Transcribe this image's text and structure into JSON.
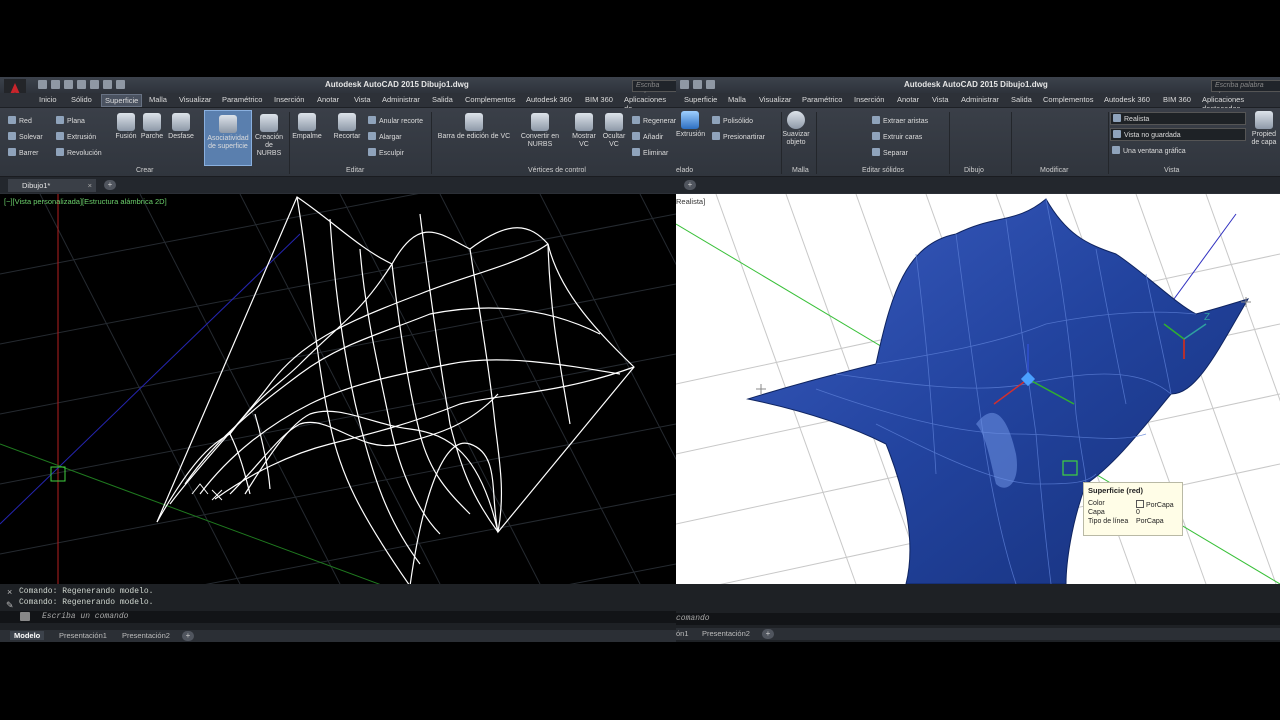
{
  "left": {
    "window_title": "Autodesk AutoCAD 2015   Dibujo1.dwg",
    "search_placeholder": "Escriba pala",
    "ribbon_tabs": [
      "Inicio",
      "Sólido",
      "Superficie",
      "Malla",
      "Visualizar",
      "Paramétrico",
      "Inserción",
      "Anotar",
      "Vista",
      "Administrar",
      "Salida",
      "Complementos",
      "Autodesk 360",
      "BIM 360",
      "Aplicaciones de"
    ],
    "active_tab": "Superficie",
    "ribbon": {
      "crear_small": [
        "Red",
        "Solevar",
        "Barrer",
        "Plana",
        "Extrusión",
        "Revolución"
      ],
      "crear_buttons": [
        "Fusión",
        "Parche",
        "Desfase"
      ],
      "asociatividad": [
        "Asociatividad",
        "de superficie"
      ],
      "creacion": [
        "Creación",
        "de NURBS"
      ],
      "panel_crear": "Crear",
      "empalme": "Empalme",
      "recortar": "Recortar",
      "editar_small": [
        "Anular recorte",
        "Alargar",
        "Esculpir"
      ],
      "panel_editar": "Editar",
      "barra_vc": "Barra de edición de VC",
      "convertir": [
        "Convertir en",
        "NURBS"
      ],
      "mostrar": [
        "Mostrar",
        "VC"
      ],
      "ocultar": [
        "Ocultar",
        "VC"
      ],
      "vertices_small": [
        "Regenerar",
        "Añadir",
        "Eliminar"
      ],
      "panel_vertices": "Vértices de control"
    },
    "file_tab": "Dibujo1*",
    "viewport_label": "[−][Vista personalizada][Estructura alámbrica 2D]",
    "command_history": [
      "Comando:  Regenerando modelo.",
      "Comando:  Regenerando modelo."
    ],
    "command_prompt": "Escriba un comando",
    "layout_tabs": [
      "Modelo",
      "Presentación1",
      "Presentación2"
    ]
  },
  "right": {
    "window_title": "Autodesk AutoCAD 2015   Dibujo1.dwg",
    "search_placeholder": "Escriba palabra clave",
    "ribbon_tabs": [
      "Superficie",
      "Malla",
      "Visualizar",
      "Paramétrico",
      "Inserción",
      "Anotar",
      "Vista",
      "Administrar",
      "Salida",
      "Complementos",
      "Autodesk 360",
      "BIM 360",
      "Aplicaciones destacadas"
    ],
    "ribbon": {
      "extrusion": "Extrusión",
      "modelado_small": [
        "Polisólido",
        "Presionartirar"
      ],
      "panel_modelado": "elado",
      "suavizar": [
        "Suavizar",
        "objeto"
      ],
      "panel_malla": "Malla",
      "editar_small": [
        "Extraer aristas",
        "Extruir caras",
        "Separar"
      ],
      "panel_editar_solidos": "Editar sólidos",
      "panel_dibujo": "Dibujo",
      "panel_modificar": "Modificar",
      "visual_style": "Realista",
      "view_saved": "Vista no guardada",
      "viewport_config": "Una ventana gráfica",
      "panel_vista": "Vista",
      "propiedades": [
        "Propied",
        "de capa"
      ]
    },
    "viewport_label": "Realista]",
    "tooltip": {
      "title": "Superficie (red)",
      "rows": [
        {
          "label": "Color",
          "value": "PorCapa"
        },
        {
          "label": "Capa",
          "value": "0"
        },
        {
          "label": "Tipo de línea",
          "value": "PorCapa"
        }
      ]
    },
    "axis_label": "Z",
    "command_prompt": "comando",
    "layout_tabs": [
      "ón1",
      "Presentación2"
    ]
  },
  "colors": {
    "accent_red": "#c8242b",
    "surface_blue": "#22439e",
    "wire_green": "#3fd23f",
    "wire_white": "#ffffff"
  }
}
